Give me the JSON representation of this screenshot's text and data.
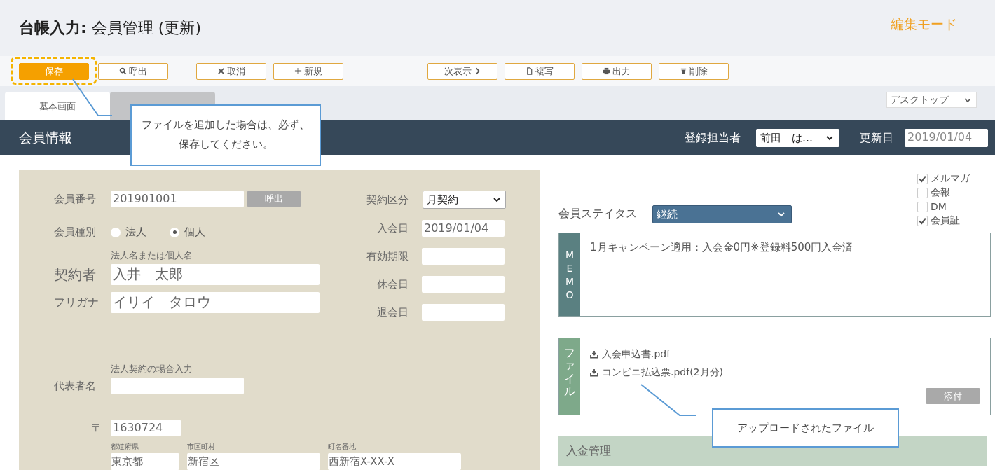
{
  "header": {
    "title_bold": "台帳入力:",
    "title": "会員管理 (更新)",
    "mode": "編集モード"
  },
  "toolbar": [
    {
      "label": "保存",
      "kind": "primary"
    },
    {
      "label": "呼出",
      "kind": "search"
    },
    {
      "label": "取消",
      "kind": "close"
    },
    {
      "label": "新規",
      "kind": "plus"
    },
    {
      "label": "次表示",
      "kind": "next"
    },
    {
      "label": "複写",
      "kind": "copy"
    },
    {
      "label": "出力",
      "kind": "print"
    },
    {
      "label": "削除",
      "kind": "trash"
    }
  ],
  "tabs": [
    {
      "label": "基本画面",
      "selected": true
    },
    {
      "selected": false
    }
  ],
  "view_select": "デスクトップ",
  "callouts": [
    {
      "text": "ファイルを追加した場合は、必ず、保存してください。"
    },
    {
      "text": "アップロードされたファイル"
    }
  ],
  "section": {
    "title": "会員情報",
    "staff_label": "登録担当者",
    "staff": "前田　は…",
    "updated_label": "更新日",
    "updated": "2019/01/04"
  },
  "form": {
    "member_no_label": "会員番号",
    "member_no": "201901001",
    "lookup": "呼出",
    "type_label": "会員種別",
    "types": [
      {
        "label": "法人",
        "selected": false
      },
      {
        "label": "個人",
        "selected": true
      }
    ],
    "name_hint": "法人名または個人名",
    "name_label": "契約者",
    "name": "入井　太郎",
    "kana_label": "フリガナ",
    "kana": "イリイ　タロウ",
    "rep_hint": "法人契約の場合入力",
    "rep_label": "代表者名",
    "zip_label": "〒",
    "zip": "1630724",
    "address": [
      {
        "hint": "都道府県",
        "value": "東京都"
      },
      {
        "hint": "市区町村",
        "value": "新宿区"
      },
      {
        "hint": "町名番地",
        "value": "西新宿X-XX-X"
      }
    ],
    "contract_label": "契約区分",
    "contract": "月契約",
    "dates": [
      {
        "label": "入会日",
        "value": "2019/01/04"
      },
      {
        "label": "有効期限"
      },
      {
        "label": "休会日"
      },
      {
        "label": "退会日"
      }
    ]
  },
  "status": {
    "label": "会員ステイタス",
    "value": "継続"
  },
  "options": [
    {
      "label": "メルマガ",
      "checked": true
    },
    {
      "label": "会報",
      "checked": false
    },
    {
      "label": "DM",
      "checked": false
    },
    {
      "label": "会員証",
      "checked": true
    }
  ],
  "memo": {
    "label": "MEMO",
    "text": "1月キャンペーン適用：入会金0円※登録料500円入金済"
  },
  "files": {
    "label": "ファイル",
    "items": [
      "入会申込書.pdf",
      "コンビニ払込票.pdf(2月分)"
    ],
    "attach": "添付"
  },
  "payment": {
    "title": "入金管理"
  }
}
